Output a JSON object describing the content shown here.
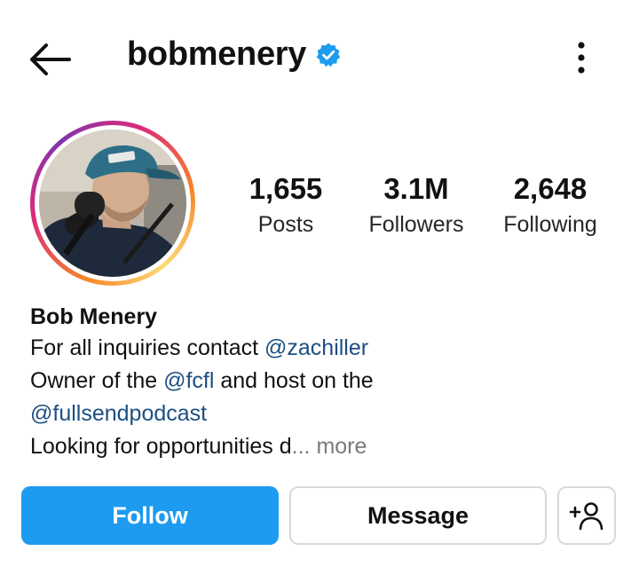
{
  "header": {
    "username": "bobmenery",
    "back_icon": "arrow-left-icon",
    "verified_icon": "verified-badge-icon",
    "more_icon": "more-vertical-icon"
  },
  "profile": {
    "avatar_icon": "profile-photo",
    "stats": [
      {
        "value": "1,655",
        "label": "Posts"
      },
      {
        "value": "3.1M",
        "label": "Followers"
      },
      {
        "value": "2,648",
        "label": "Following"
      }
    ]
  },
  "bio": {
    "name": "Bob Menery",
    "line1_text": "For all inquiries contact ",
    "line1_mention": "@zachiller",
    "line2_text_a": "Owner of the ",
    "line2_mention": "@fcfl",
    "line2_text_b": " and host on the",
    "line3_mention": "@fullsendpodcast",
    "line4_text": "Looking for opportunities d",
    "line4_more": "... more"
  },
  "actions": {
    "follow_label": "Follow",
    "message_label": "Message",
    "add_user_icon": "add-user-icon"
  },
  "colors": {
    "follow_button": "#1d9bf0",
    "mention": "#1d4f82",
    "verified": "#1d9bf0",
    "more_link": "#7a7a7a"
  }
}
